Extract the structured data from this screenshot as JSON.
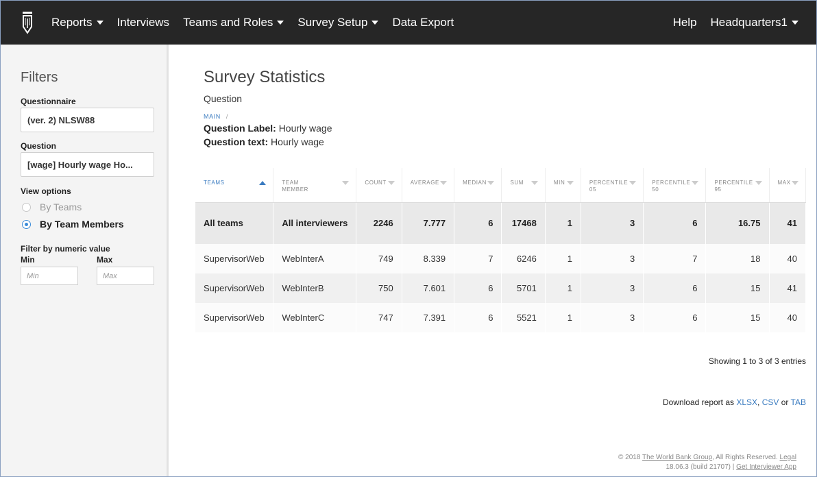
{
  "nav": {
    "items": [
      {
        "label": "Reports",
        "dropdown": true
      },
      {
        "label": "Interviews",
        "dropdown": false
      },
      {
        "label": "Teams and Roles",
        "dropdown": true
      },
      {
        "label": "Survey Setup",
        "dropdown": true
      },
      {
        "label": "Data Export",
        "dropdown": false
      }
    ],
    "help": "Help",
    "user": "Headquarters1"
  },
  "sidebar": {
    "title": "Filters",
    "questionnaire_label": "Questionnaire",
    "questionnaire_value": "(ver. 2) NLSW88",
    "question_label": "Question",
    "question_value": "[wage] Hourly wage Ho...",
    "view_options_label": "View options",
    "view_by_teams": "By Teams",
    "view_by_members": "By Team Members",
    "numeric_filter_label": "Filter by numeric value",
    "min_label": "Min",
    "max_label": "Max",
    "min_placeholder": "Min",
    "max_placeholder": "Max"
  },
  "main": {
    "title": "Survey Statistics",
    "subtitle": "Question",
    "breadcrumb": "MAIN",
    "breadcrumb_sep": "/",
    "question_label_key": "Question Label:",
    "question_label_value": "Hourly wage",
    "question_text_key": "Question text:",
    "question_text_value": "Hourly wage"
  },
  "table": {
    "columns": [
      "TEAMS",
      "TEAM MEMBER",
      "COUNT",
      "AVERAGE",
      "MEDIAN",
      "SUM",
      "MIN",
      "PERCENTILE 05",
      "PERCENTILE 50",
      "PERCENTILE 95",
      "MAX"
    ],
    "total": [
      "All teams",
      "All interviewers",
      "2246",
      "7.777",
      "6",
      "17468",
      "1",
      "3",
      "6",
      "16.75",
      "41"
    ],
    "rows": [
      [
        "SupervisorWeb",
        "WebInterA",
        "749",
        "8.339",
        "7",
        "6246",
        "1",
        "3",
        "7",
        "18",
        "40"
      ],
      [
        "SupervisorWeb",
        "WebInterB",
        "750",
        "7.601",
        "6",
        "5701",
        "1",
        "3",
        "6",
        "15",
        "41"
      ],
      [
        "SupervisorWeb",
        "WebInterC",
        "747",
        "7.391",
        "6",
        "5521",
        "1",
        "3",
        "6",
        "15",
        "40"
      ]
    ]
  },
  "showing": "Showing 1 to 3 of 3 entries",
  "download": {
    "prefix": "Download report as",
    "xlsx": "XLSX",
    "csv": "CSV",
    "or": "or",
    "tab": "TAB"
  },
  "footer": {
    "copyright": "© 2018",
    "org": "The World Bank Group",
    "rights": ", All Rights Reserved.",
    "legal": "Legal",
    "version": "18.06.3 (build 21707) |",
    "app_link": "Get Interviewer App"
  }
}
